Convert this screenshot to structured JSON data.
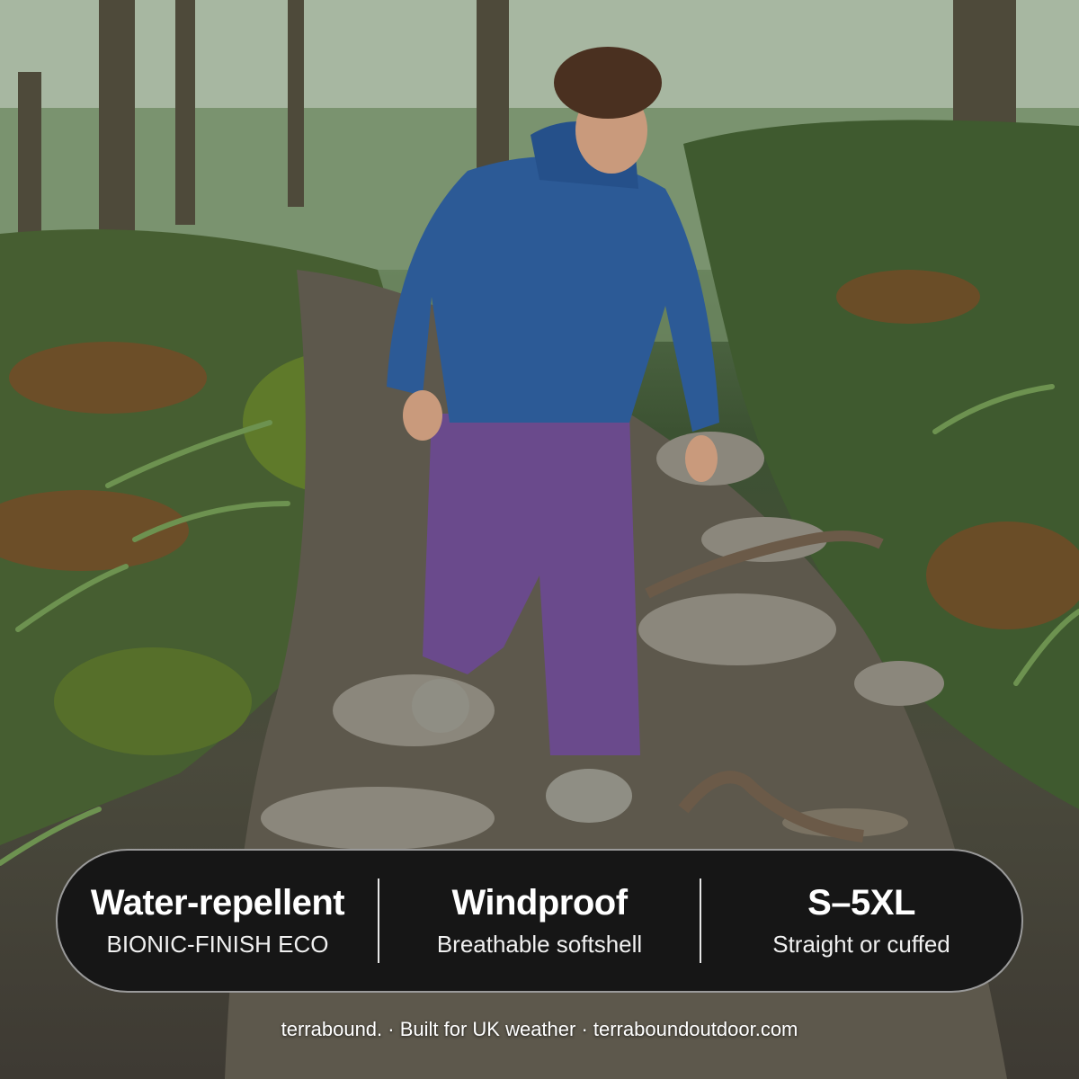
{
  "image": {
    "description_tags": [
      "hiker",
      "forest-trail",
      "blue-jacket",
      "purple-trousers",
      "ferns",
      "mossy-rocks"
    ]
  },
  "features": [
    {
      "title": "Water-repellent",
      "subtitle": "BIONIC-FINISH ECO"
    },
    {
      "title": "Windproof",
      "subtitle": "Breathable softshell"
    },
    {
      "title": "S–5XL",
      "subtitle": "Straight or cuffed"
    }
  ],
  "footer": {
    "text": "terrabound. · Built for UK weather · terraboundoutdoor.com"
  },
  "colors": {
    "jacket": "#2c5a96",
    "trousers": "#6a4a8c",
    "bar": "#161616"
  }
}
